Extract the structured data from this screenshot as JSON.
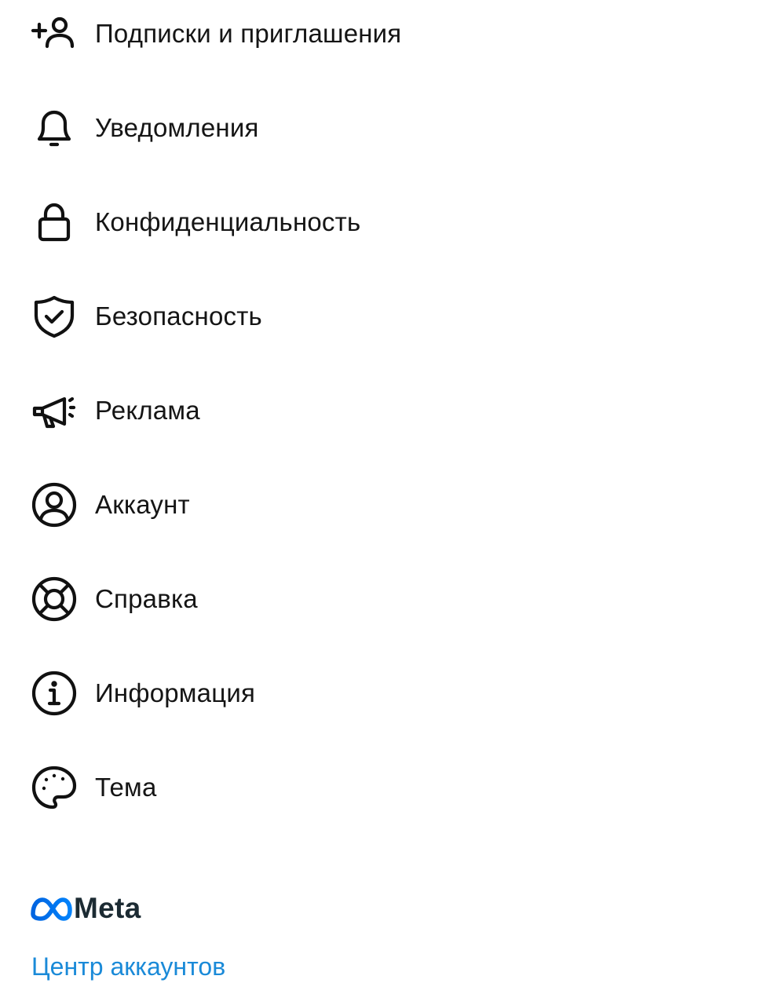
{
  "menu": {
    "items": [
      {
        "label": "Подписки и приглашения",
        "icon": "add-person-icon"
      },
      {
        "label": "Уведомления",
        "icon": "bell-icon"
      },
      {
        "label": "Конфиденциальность",
        "icon": "lock-icon"
      },
      {
        "label": "Безопасность",
        "icon": "shield-check-icon"
      },
      {
        "label": "Реклама",
        "icon": "megaphone-icon"
      },
      {
        "label": "Аккаунт",
        "icon": "user-circle-icon"
      },
      {
        "label": "Справка",
        "icon": "lifebuoy-icon"
      },
      {
        "label": "Информация",
        "icon": "info-icon"
      },
      {
        "label": "Тема",
        "icon": "palette-icon"
      }
    ]
  },
  "footer": {
    "brand": "Meta",
    "account_center_link": "Центр аккаунтов",
    "link_color": "#1a8ad8",
    "brand_color": "#0668e1"
  }
}
